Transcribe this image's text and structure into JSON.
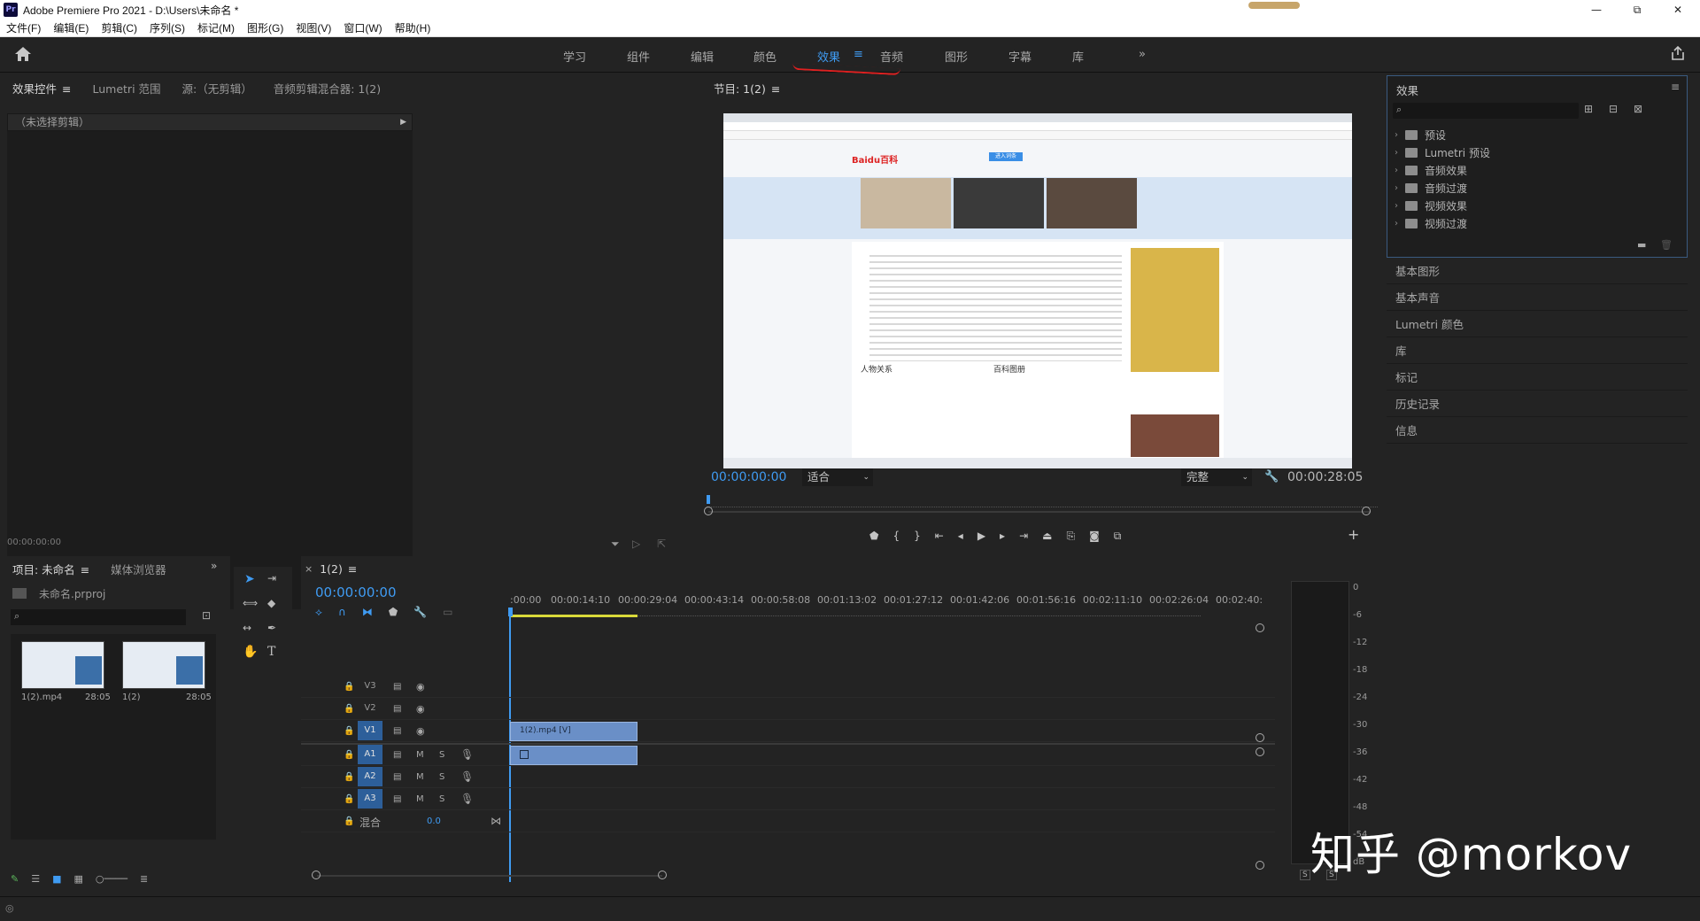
{
  "titlebar": {
    "title": "Adobe Premiere Pro 2021 - D:\\Users\\未命名 *",
    "logo": "Pr",
    "minimize": "—",
    "maximize": "⧉",
    "close": "✕"
  },
  "menubar": [
    "文件(F)",
    "编辑(E)",
    "剪辑(C)",
    "序列(S)",
    "标记(M)",
    "图形(G)",
    "视图(V)",
    "窗口(W)",
    "帮助(H)"
  ],
  "workspaces": {
    "tabs": [
      "学习",
      "组件",
      "编辑",
      "颜色",
      "效果",
      "音频",
      "图形",
      "字幕",
      "库"
    ],
    "active": "效果",
    "more": "»"
  },
  "effect_controls": {
    "tabs": [
      "效果控件",
      "Lumetri 范围",
      "源:（无剪辑）",
      "音频剪辑混合器: 1(2)"
    ],
    "no_clip": "（未选择剪辑）",
    "timecode": "00:00:00:00"
  },
  "program": {
    "title": "节目: 1(2)",
    "timecode_left": "00:00:00:00",
    "fit": "适合",
    "quality": "完整",
    "timecode_right": "00:00:28:05"
  },
  "screen_content": {
    "logo": "Baidu百科",
    "sections": [
      "人物关系",
      "百科图册"
    ],
    "button": "进入词条"
  },
  "effects_panel": {
    "title": "效果",
    "items": [
      "预设",
      "Lumetri 预设",
      "音频效果",
      "音频过渡",
      "视频效果",
      "视频过渡"
    ]
  },
  "side_panels": [
    "基本图形",
    "基本声音",
    "Lumetri 颜色",
    "库",
    "标记",
    "历史记录",
    "信息"
  ],
  "project": {
    "tabs": [
      "项目: 未命名",
      "媒体浏览器"
    ],
    "file": "未命名.prproj",
    "clips": [
      {
        "name": "1(2).mp4",
        "duration": "28:05"
      },
      {
        "name": "1(2)",
        "duration": "28:05"
      }
    ]
  },
  "timeline": {
    "sequence": "1(2)",
    "timecode": "00:00:00:00",
    "ruler": [
      ":00:00",
      "00:00:14:10",
      "00:00:29:04",
      "00:00:43:14",
      "00:00:58:08",
      "00:01:13:02",
      "00:01:27:12",
      "00:01:42:06",
      "00:01:56:16",
      "00:02:11:10",
      "00:02:26:04",
      "00:02:40:"
    ],
    "tracks": [
      "V3",
      "V2",
      "V1",
      "A1",
      "A2",
      "A3"
    ],
    "mix_label": "混合",
    "mix_value": "0.0",
    "clip_label": "1(2).mp4 [V]"
  },
  "meter": {
    "scale": [
      "0",
      "-6",
      "-12",
      "-18",
      "-24",
      "-30",
      "-36",
      "-42",
      "-48",
      "-54",
      "dB"
    ],
    "solo": "S"
  },
  "watermark": "知乎 @morkov",
  "colors": {
    "accent": "#3f9bf2",
    "track_active": "#2d5f9a",
    "clip": "#6a8fc7",
    "underline": "#e02020"
  }
}
